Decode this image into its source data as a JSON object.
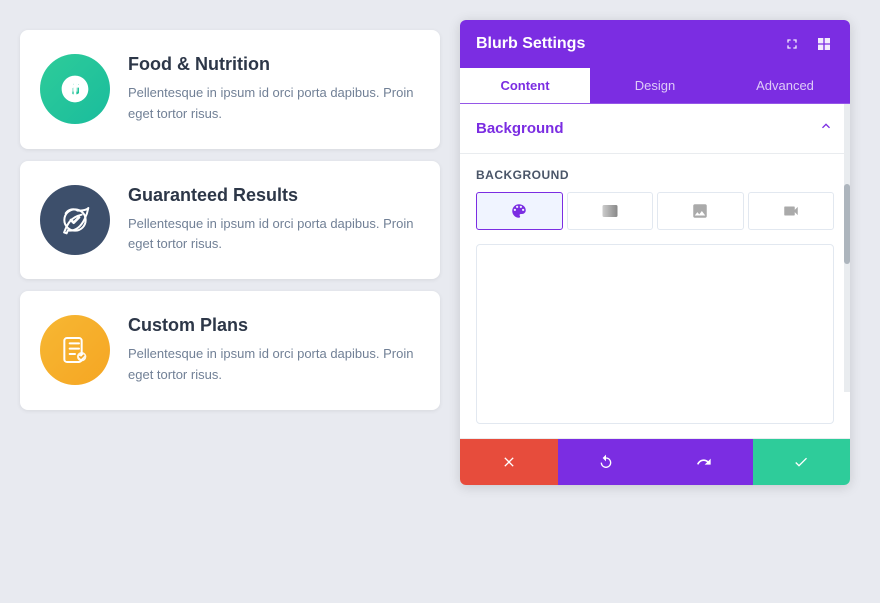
{
  "left": {
    "cards": [
      {
        "id": "food-nutrition",
        "title": "Food & Nutrition",
        "text": "Pellentesque in ipsum id orci porta dapibus. Proin eget tortor risus.",
        "icon": "food",
        "iconAriaLabel": "food-icon"
      },
      {
        "id": "guaranteed-results",
        "title": "Guaranteed Results",
        "text": "Pellentesque in ipsum id orci porta dapibus. Proin eget tortor risus.",
        "icon": "guaranteed",
        "iconAriaLabel": "guaranteed-icon"
      },
      {
        "id": "custom-plans",
        "title": "Custom Plans",
        "text": "Pellentesque in ipsum id orci porta dapibus. Proin eget tortor risus.",
        "icon": "custom",
        "iconAriaLabel": "custom-icon"
      }
    ]
  },
  "right": {
    "title": "Blurb Settings",
    "tabs": [
      {
        "id": "content",
        "label": "Content",
        "active": true
      },
      {
        "id": "design",
        "label": "Design",
        "active": false
      },
      {
        "id": "advanced",
        "label": "Advanced",
        "active": false
      }
    ],
    "section": {
      "title": "Background",
      "field_label": "Background"
    },
    "footer": {
      "cancel": "✕",
      "reset": "↺",
      "redo": "↻",
      "save": "✓"
    }
  }
}
